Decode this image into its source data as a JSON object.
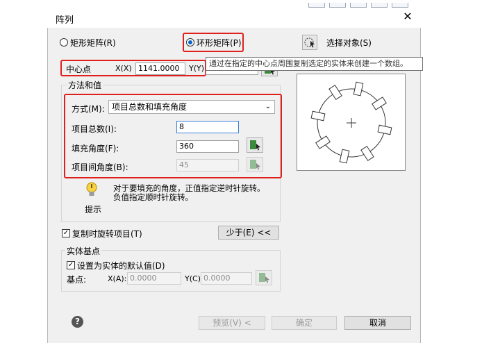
{
  "window": {
    "title": "阵列",
    "close_glyph": "✕"
  },
  "modes": {
    "rect_label": "矩形矩阵(R)",
    "polar_label": "环形矩阵(P)",
    "selected": "polar"
  },
  "select_objects": {
    "label": "选择对象(S)"
  },
  "center": {
    "label": "中心点",
    "x_label": "X(X)",
    "x_value": "1141.0000",
    "y_label": "Y(Y)",
    "y_value": ""
  },
  "tooltip": {
    "text": "通过在指定的中心点周围复制选定的实体来创建一个数组。"
  },
  "method_group": {
    "title": "方法和值",
    "method_label": "方式(M):",
    "method_value": "项目总数和填充角度",
    "total_label": "项目总数(I):",
    "total_value": "8",
    "fill_label": "填充角度(F):",
    "fill_value": "360",
    "between_label": "项目间角度(B):",
    "between_value": "45"
  },
  "hint": {
    "text_line1": "对于要填充的角度，正值指定逆时针旋转。",
    "text_line2": "负值指定顺时针旋转。",
    "label": "提示"
  },
  "rotate": {
    "label": "复制时旋转项目(T)",
    "checked": true
  },
  "less_button": {
    "label": "少于(E) <<"
  },
  "base": {
    "title": "实体基点",
    "default_label": "设置为实体的默认值(D)",
    "default_checked": true,
    "point_label": "基点:",
    "x_label": "X(A):",
    "x_value": "0.0000",
    "y_label": "Y(C):",
    "y_value": "0.0000"
  },
  "footer": {
    "help_glyph": "?",
    "preview_label": "预览(V) <",
    "ok_label": "确定",
    "cancel_label": "取消"
  },
  "colors": {
    "highlight": "#e0201c",
    "radio_dot": "#0a64c8"
  }
}
